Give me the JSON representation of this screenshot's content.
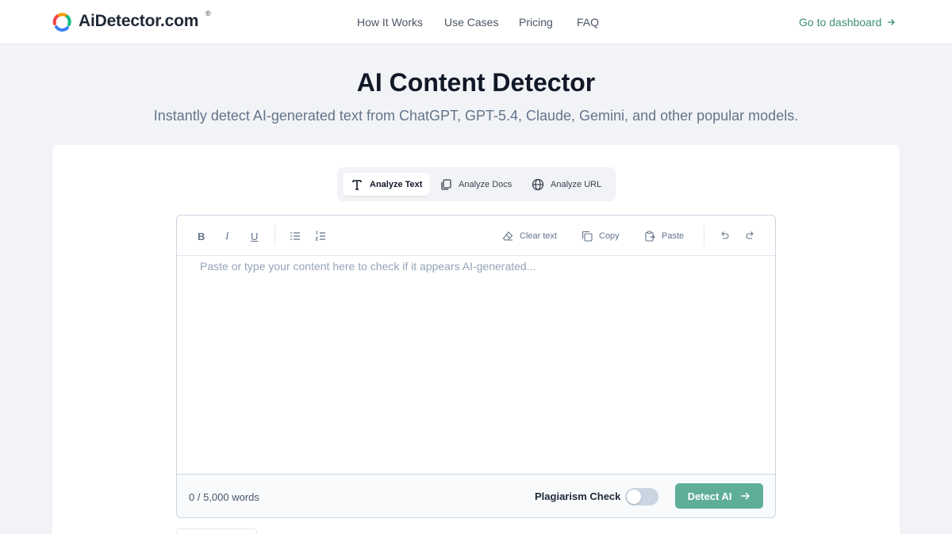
{
  "header": {
    "logo_text": "AiDetector.com",
    "logo_reg": "®",
    "nav": [
      "How It Works",
      "Use Cases",
      "Pricing",
      "FAQ"
    ],
    "dashboard_link": "Go to dashboard"
  },
  "hero": {
    "title": "AI Content Detector",
    "subtitle": "Instantly detect AI-generated text from ChatGPT, GPT-5.4, Claude, Gemini, and other popular models."
  },
  "tabs": [
    {
      "label": "Analyze Text",
      "icon": "text-icon",
      "active": true
    },
    {
      "label": "Analyze Docs",
      "icon": "docs-icon",
      "active": false
    },
    {
      "label": "Analyze URL",
      "icon": "globe-icon",
      "active": false
    }
  ],
  "toolbar": {
    "bold": "B",
    "italic": "I",
    "underline": "U",
    "clear_label": "Clear text",
    "copy_label": "Copy",
    "paste_label": "Paste"
  },
  "editor": {
    "placeholder": "Paste or type your content here to check if it appears AI-generated...",
    "value": ""
  },
  "footer": {
    "word_count": "0 / 5,000 words",
    "plagiarism_label": "Plagiarism Check",
    "plagiarism_enabled": false,
    "detect_label": "Detect AI"
  },
  "colors": {
    "accent": "#3b8f77",
    "button": "#5fae98",
    "page_bg": "#f1f3f6"
  }
}
